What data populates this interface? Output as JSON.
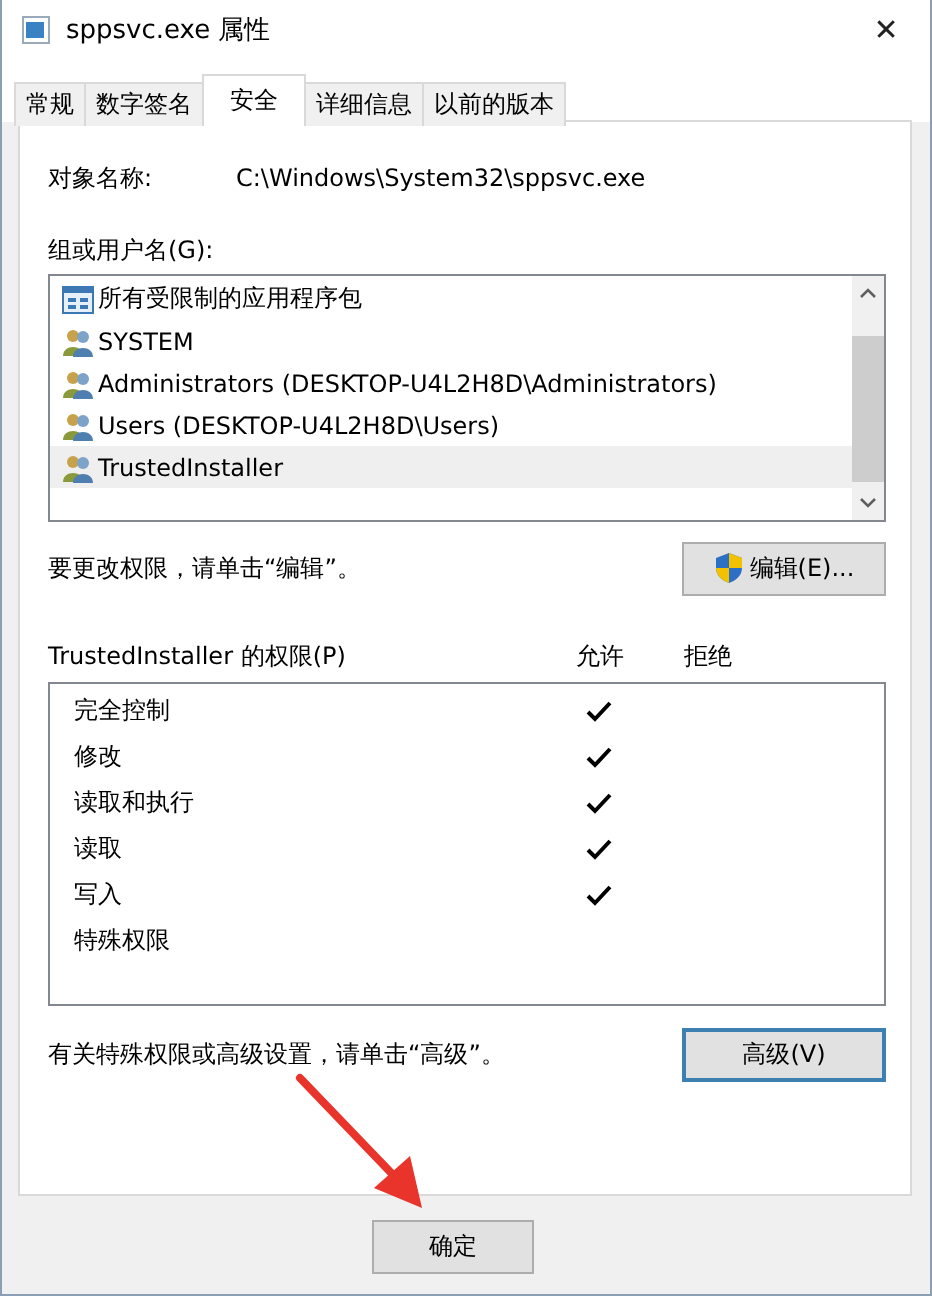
{
  "window": {
    "title": "sppsvc.exe 属性",
    "close": "✕"
  },
  "tabs": [
    {
      "label": "常规",
      "selected": false
    },
    {
      "label": "数字签名",
      "selected": false
    },
    {
      "label": "安全",
      "selected": true
    },
    {
      "label": "详细信息",
      "selected": false
    },
    {
      "label": "以前的版本",
      "selected": false
    }
  ],
  "object_name": {
    "label": "对象名称:",
    "value": "C:\\Windows\\System32\\sppsvc.exe"
  },
  "groups": {
    "label": "组或用户名(G):",
    "items": [
      {
        "name": "所有受限制的应用程序包",
        "kind": "package",
        "selected": false
      },
      {
        "name": "SYSTEM",
        "kind": "group",
        "selected": false
      },
      {
        "name": "Administrators (DESKTOP-U4L2H8D\\Administrators)",
        "kind": "group",
        "selected": false
      },
      {
        "name": "Users (DESKTOP-U4L2H8D\\Users)",
        "kind": "group",
        "selected": false
      },
      {
        "name": "TrustedInstaller",
        "kind": "group",
        "selected": true
      }
    ]
  },
  "edit_hint": "要更改权限，请单击“编辑”。",
  "edit_button": "编辑(E)...",
  "permissions": {
    "title": "TrustedInstaller 的权限(P)",
    "allow_label": "允许",
    "deny_label": "拒绝",
    "rows": [
      {
        "name": "完全控制",
        "allow": true,
        "deny": false
      },
      {
        "name": "修改",
        "allow": true,
        "deny": false
      },
      {
        "name": "读取和执行",
        "allow": true,
        "deny": false
      },
      {
        "name": "读取",
        "allow": true,
        "deny": false
      },
      {
        "name": "写入",
        "allow": true,
        "deny": false
      },
      {
        "name": "特殊权限",
        "allow": false,
        "deny": false
      }
    ]
  },
  "advanced_hint": "有关特殊权限或高级设置，请单击“高级”。",
  "advanced_button": "高级(V)",
  "ok_button": "确定"
}
